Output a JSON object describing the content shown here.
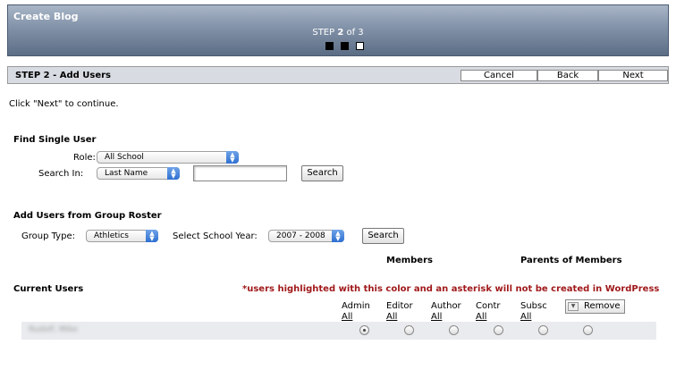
{
  "wizard": {
    "title": "Create Blog",
    "step_prefix": "STEP ",
    "step_current": "2",
    "step_suffix": " of 3"
  },
  "step_bar": {
    "title": "STEP 2 - Add Users",
    "cancel_label": "Cancel",
    "back_label": "Back",
    "next_label": "Next"
  },
  "instruction": "Click \"Next\" to continue.",
  "find_single_user": {
    "title": "Find Single User",
    "role_label": "Role:",
    "role_value": "All School",
    "search_in_label": "Search In:",
    "search_in_value": "Last Name",
    "search_value": "",
    "search_button": "Search"
  },
  "group_roster": {
    "title": "Add Users from Group Roster",
    "group_type_label": "Group Type:",
    "group_type_value": "Athletics",
    "school_year_label": "Select School Year:",
    "school_year_value": "2007 - 2008",
    "search_button": "Search"
  },
  "headers": {
    "members": "Members",
    "parents_of_members": "Parents of Members"
  },
  "current_users": {
    "title": "Current Users",
    "warning": "*users highlighted with this color and an asterisk will not be created in WordPress",
    "columns": [
      {
        "label": "Admin",
        "all": "All"
      },
      {
        "label": "Editor",
        "all": "All"
      },
      {
        "label": "Author",
        "all": "All"
      },
      {
        "label": "Contr",
        "all": "All"
      },
      {
        "label": "Subsc",
        "all": "All"
      }
    ],
    "remove_label": "Remove",
    "rows": [
      {
        "name": "Rudolf, Mike",
        "selected": "Admin"
      }
    ]
  }
}
